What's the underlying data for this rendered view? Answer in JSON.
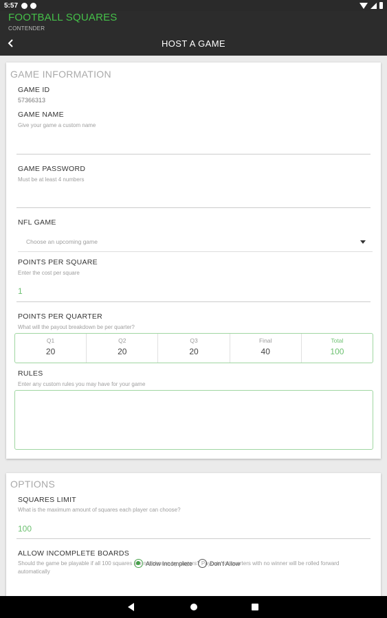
{
  "status_bar": {
    "time": "5:57"
  },
  "header": {
    "app_title": "FOOTBALL SQUARES",
    "app_subtitle": "CONTENDER",
    "page_title": "HOST A GAME"
  },
  "game_info": {
    "section_title": "GAME INFORMATION",
    "game_id": {
      "label": "GAME ID",
      "value": "57366313"
    },
    "game_name": {
      "label": "GAME NAME",
      "help": "Give your game a custom name",
      "value": ""
    },
    "game_password": {
      "label": "GAME PASSWORD",
      "help": "Must be at least 4 numbers",
      "value": ""
    },
    "nfl_game": {
      "label": "NFL GAME",
      "placeholder": "Choose an upcoming game"
    },
    "points_per_square": {
      "label": "POINTS PER SQUARE",
      "help": "Enter the cost per square",
      "value": "1"
    },
    "points_per_quarter": {
      "label": "POINTS PER QUARTER",
      "help": "What will the payout breakdown be per quarter?",
      "columns": [
        {
          "header": "Q1",
          "value": "20"
        },
        {
          "header": "Q2",
          "value": "20"
        },
        {
          "header": "Q3",
          "value": "20"
        },
        {
          "header": "Final",
          "value": "40"
        },
        {
          "header": "Total",
          "value": "100"
        }
      ]
    },
    "rules": {
      "label": "RULES",
      "help": "Enter any custom rules you may have for your game",
      "value": ""
    }
  },
  "options": {
    "section_title": "OPTIONS",
    "squares_limit": {
      "label": "SQUARES LIMIT",
      "help": "What is the maximum amount of squares each player can choose?",
      "value": "100"
    },
    "allow_incomplete": {
      "label": "ALLOW INCOMPLETE BOARDS",
      "help": "Should the game be playable if all 100 squares are not chosen by players? Payouts for quarters with no winner will be rolled forward automatically",
      "option_allow": "Allow Incomplete",
      "option_deny": "Don't Allow",
      "selected": "Allow Incomplete"
    }
  },
  "colors": {
    "accent": "#45c049",
    "header_bg": "#2c2c2c",
    "field_border": "#9fd6a1"
  }
}
